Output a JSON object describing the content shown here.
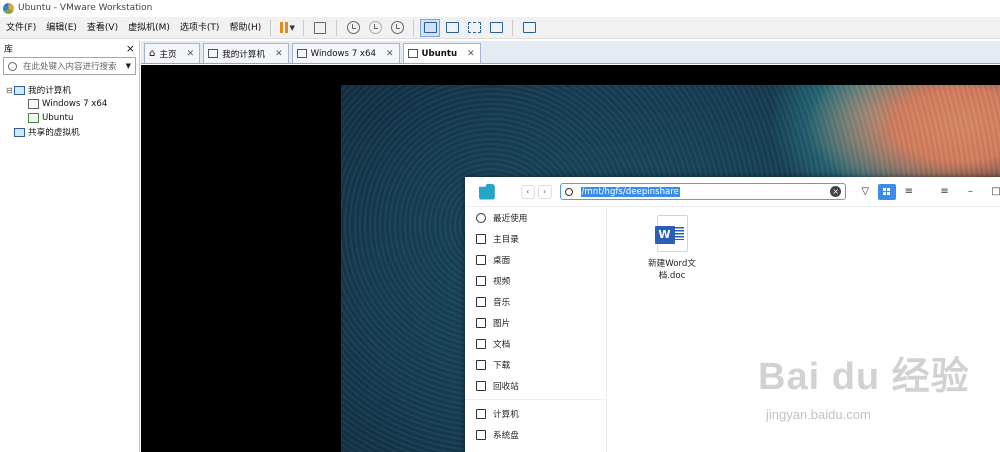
{
  "window": {
    "title": "Ubuntu - VMware Workstation"
  },
  "menu": [
    "文件(F)",
    "编辑(E)",
    "查看(V)",
    "虚拟机(M)",
    "选项卡(T)",
    "帮助(H)"
  ],
  "library": {
    "title": "库",
    "close": "×",
    "search_placeholder": "在此处键入内容进行搜索",
    "tree": [
      {
        "label": "我的计算机",
        "level": 0
      },
      {
        "label": "Windows 7 x64",
        "level": 1
      },
      {
        "label": "Ubuntu",
        "level": 1
      },
      {
        "label": "共享的虚拟机",
        "level": 0
      }
    ]
  },
  "tabs": [
    {
      "label": "主页",
      "active": false
    },
    {
      "label": "我的计算机",
      "active": false
    },
    {
      "label": "Windows 7 x64",
      "active": false
    },
    {
      "label": "Ubuntu",
      "active": true
    }
  ],
  "file_manager": {
    "path": "/mnt/hgfs/deepinshare",
    "sidebar": [
      {
        "label": "最近使用",
        "icon": "clock-icon"
      },
      {
        "label": "主目录",
        "icon": "home-icon"
      },
      {
        "label": "桌面",
        "icon": "desktop-icon"
      },
      {
        "label": "视频",
        "icon": "video-icon"
      },
      {
        "label": "音乐",
        "icon": "music-icon"
      },
      {
        "label": "图片",
        "icon": "picture-icon"
      },
      {
        "label": "文档",
        "icon": "document-icon"
      },
      {
        "label": "下载",
        "icon": "download-icon"
      },
      {
        "label": "回收站",
        "icon": "trash-icon"
      },
      {
        "label": "计算机",
        "icon": "computer-icon"
      },
      {
        "label": "系统盘",
        "icon": "disk-icon"
      }
    ],
    "files": [
      {
        "name_line1": "新建Word文",
        "name_line2": "档.doc"
      }
    ]
  },
  "watermark": {
    "brand": "Bai du 经验",
    "url": "jingyan.baidu.com"
  }
}
